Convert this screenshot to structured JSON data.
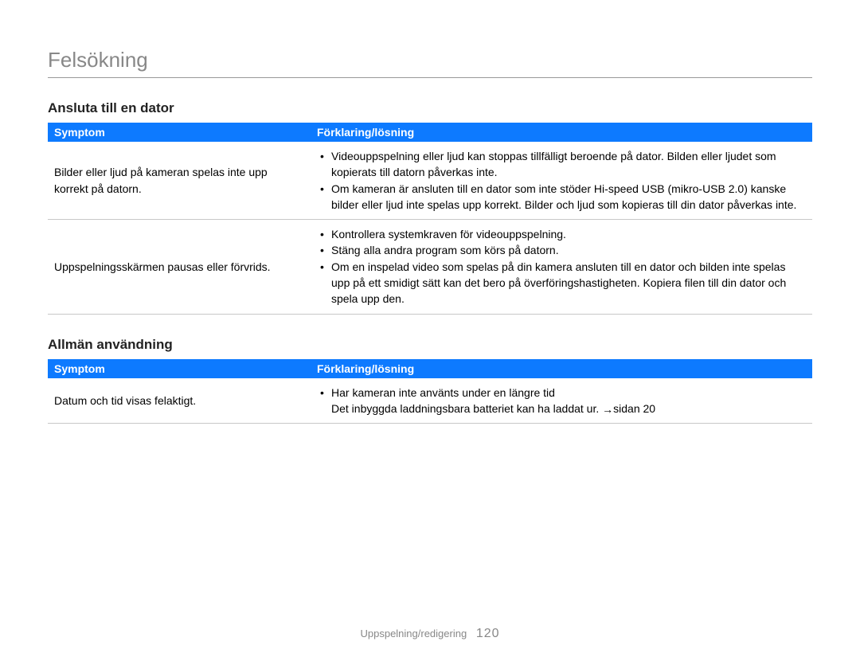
{
  "page_title": "Felsökning",
  "sections": [
    {
      "title": "Ansluta till en dator",
      "headers": {
        "symptom": "Symptom",
        "solution": "Förklaring/lösning"
      },
      "rows": [
        {
          "symptom": "Bilder eller ljud på kameran spelas inte upp korrekt på datorn.",
          "bullets": [
            "Videouppspelning eller ljud kan stoppas tillfälligt beroende på dator. Bilden eller ljudet som kopierats till datorn påverkas inte.",
            "Om kameran är ansluten till en dator som inte stöder Hi-speed USB (mikro-USB 2.0) kanske bilder eller ljud inte spelas upp korrekt. Bilder och ljud som kopieras till din dator påverkas inte."
          ]
        },
        {
          "symptom": "Uppspelningsskärmen pausas eller förvrids.",
          "bullets": [
            "Kontrollera systemkraven för videouppspelning.",
            "Stäng alla andra program som körs på datorn.",
            "Om en inspelad video som spelas på din kamera ansluten till en dator och bilden inte spelas upp på ett smidigt sätt kan det bero på överföringshastigheten. Kopiera filen till din dator och spela upp den."
          ]
        }
      ]
    },
    {
      "title": "Allmän användning",
      "headers": {
        "symptom": "Symptom",
        "solution": "Förklaring/lösning"
      },
      "rows": [
        {
          "symptom": "Datum och tid visas felaktigt.",
          "bullets": [
            "Har kameran inte använts under en längre tid"
          ],
          "extra": "Det inbyggda laddningsbara batteriet kan ha laddat ur. ",
          "extra2": "sidan 20"
        }
      ]
    }
  ],
  "footer": {
    "section": "Uppspelning/redigering",
    "page": "120"
  }
}
